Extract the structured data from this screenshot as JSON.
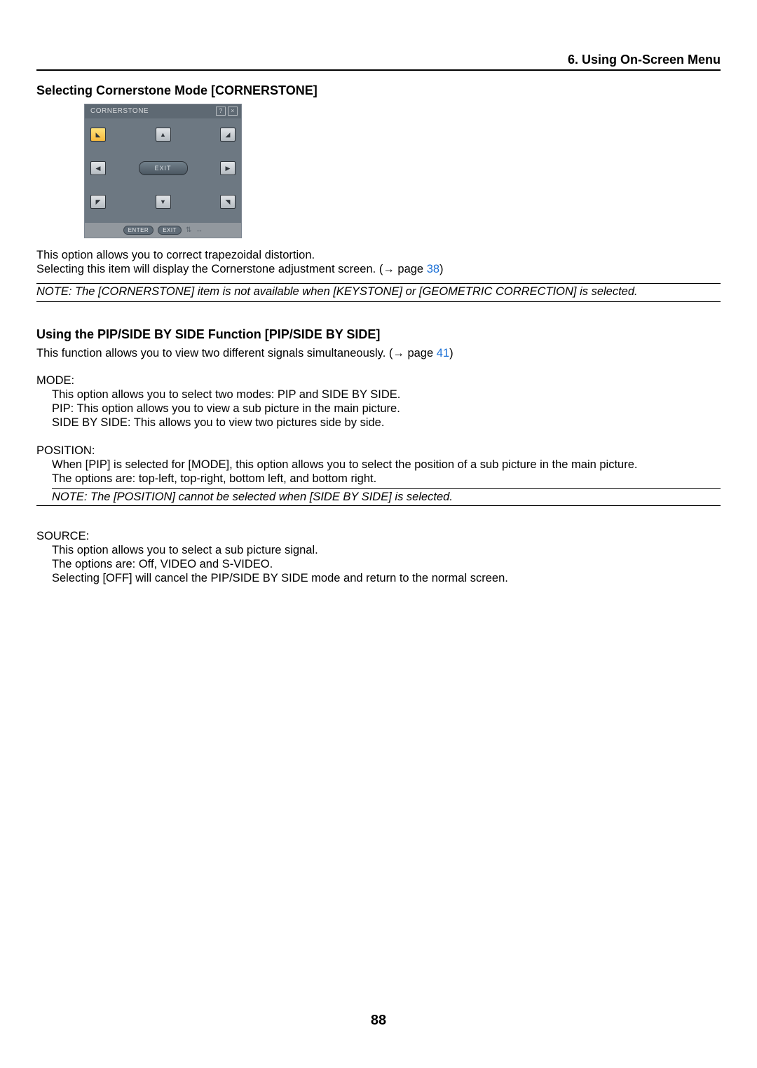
{
  "header": {
    "chapter": "6. Using On-Screen Menu"
  },
  "section1": {
    "title": "Selecting Cornerstone Mode [CORNERSTONE]",
    "osd": {
      "titlebar": "CORNERSTONE",
      "exit_label": "EXIT",
      "footer": {
        "enter": "ENTER",
        "exit": "EXIT"
      }
    },
    "para1": "This option allows you to correct trapezoidal distortion.",
    "para2a": "Selecting this item will display the Cornerstone adjustment screen. (",
    "para2_arrow": "→",
    "para2b": " page ",
    "para2_link": "38",
    "para2c": ")",
    "note": "NOTE:  The [CORNERSTONE] item is not available when [KEYSTONE] or [GEOMETRIC CORRECTION] is selected."
  },
  "section2": {
    "title": "Using the PIP/SIDE BY SIDE Function [PIP/SIDE BY SIDE]",
    "intro_a": "This function allows you to view two different signals simultaneously. (",
    "intro_arrow": "→",
    "intro_b": " page ",
    "intro_link": "41",
    "intro_c": ")",
    "mode": {
      "term": "MODE:",
      "l1": "This option allows you to select two modes: PIP and SIDE BY SIDE.",
      "l2": "PIP: This option allows you to view a sub picture in the main picture.",
      "l3": "SIDE BY SIDE: This allows you to view two pictures side by side."
    },
    "position": {
      "term": "POSITION:",
      "l1": "When [PIP] is selected for [MODE], this option allows you to select the position of a sub picture in the main picture.",
      "l2": "The options are: top-left, top-right, bottom left, and bottom right.",
      "note": "NOTE: The [POSITION] cannot be selected when [SIDE BY SIDE] is selected."
    },
    "source": {
      "term": "SOURCE:",
      "l1": "This option allows you to select a sub picture signal.",
      "l2": "The options are: Off, VIDEO and S-VIDEO.",
      "l3": "Selecting [OFF] will cancel the PIP/SIDE BY SIDE mode and return to the normal screen."
    }
  },
  "page_number": "88"
}
